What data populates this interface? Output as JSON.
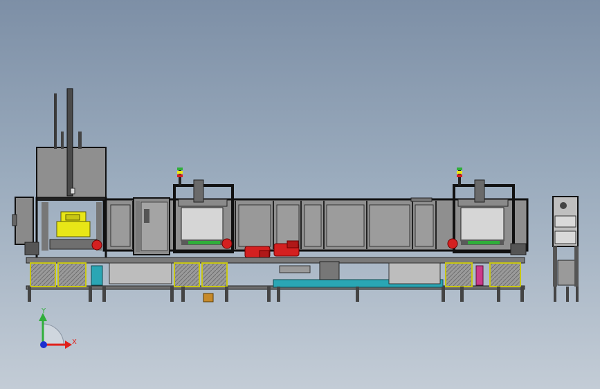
{
  "viewport": {
    "background_top": "#7d8fa6",
    "background_bottom": "#c3ccd6"
  },
  "triad": {
    "x_label": "X",
    "y_label": "Y",
    "x_color": "#e0201a",
    "y_color": "#2fae3a",
    "z_color": "#1b2fd0"
  },
  "colors": {
    "panel": "#8e8e8e",
    "frame": "#1a1a1a",
    "motor": "#d42020",
    "yellow_part": "#e8e617",
    "teal_conveyor": "#2aa6b4",
    "brass": "#c78a2a"
  }
}
